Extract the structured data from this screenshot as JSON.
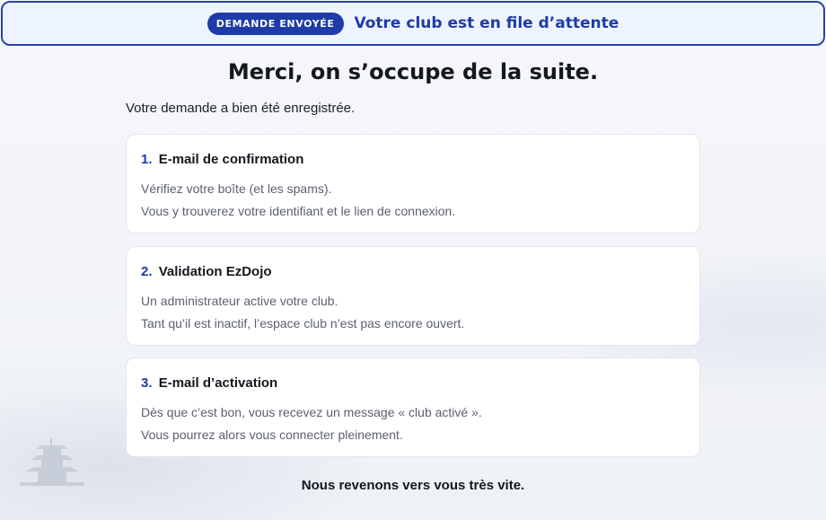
{
  "banner": {
    "badge": "DEMANDE ENVOYÉE",
    "title": "Votre club est en file d’attente"
  },
  "page_title": "Merci, on s’occupe de la suite.",
  "intro": "Votre demande a bien été enregistrée.",
  "steps": [
    {
      "number": "1.",
      "title": "E-mail de confirmation",
      "lines": [
        "Vérifiez votre boîte (et les spams).",
        "Vous y trouverez votre identifiant et le lien de connexion."
      ]
    },
    {
      "number": "2.",
      "title": "Validation EzDojo",
      "lines": [
        "Un administrateur active votre club.",
        "Tant qu’il est inactif, l’espace club n’est pas encore ouvert."
      ]
    },
    {
      "number": "3.",
      "title": "E-mail d’activation",
      "lines": [
        "Dès que c’est bon, vous recevez un message « club activé ».",
        "Vous pourrez alors vous connecter pleinement."
      ]
    }
  ],
  "footer": "Nous revenons vers vous très vite.",
  "colors": {
    "accent": "#1f3ba8",
    "banner_bg": "#eef4ff",
    "card_bg": "#ffffff",
    "muted_text": "#5b6070"
  }
}
